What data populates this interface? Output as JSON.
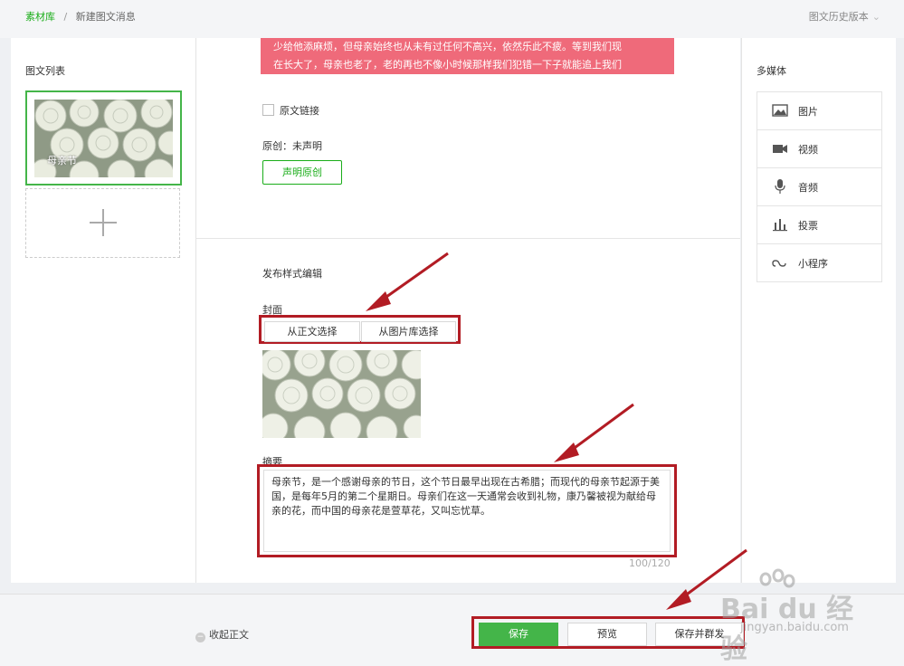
{
  "breadcrumb": {
    "root": "素材库",
    "separator": "/",
    "current": "新建图文消息"
  },
  "history": {
    "label": "图文历史版本"
  },
  "article_list": {
    "title": "图文列表",
    "item_title": "母亲节"
  },
  "editor": {
    "preview_text_line1": "少给他添麻烦，但母亲始终也从未有过任何不高兴，依然乐此不疲。等到我们现",
    "preview_text_line2": "在长大了，母亲也老了，老的再也不像小时候那样我们犯错一下子就能追上我们",
    "original_link_label": "原文链接",
    "original_status": "原创：未声明",
    "declare_button": "声明原创"
  },
  "publish": {
    "section_title": "发布样式编辑",
    "cover_label": "封面",
    "cover_from_body": "从正文选择",
    "cover_from_library": "从图片库选择",
    "abstract_label": "摘要",
    "abstract_text": "母亲节，是一个感谢母亲的节日，这个节日最早出现在古希腊；而现代的母亲节起源于美国，是每年5月的第二个星期日。母亲们在这一天通常会收到礼物，康乃馨被视为献给母亲的花，而中国的母亲花是萱草花，又叫忘忧草。",
    "counter": "100/120"
  },
  "multimedia": {
    "title": "多媒体",
    "items": [
      {
        "label": "图片",
        "icon": "image-icon"
      },
      {
        "label": "视频",
        "icon": "video-icon"
      },
      {
        "label": "音频",
        "icon": "microphone-icon"
      },
      {
        "label": "投票",
        "icon": "vote-chart-icon"
      },
      {
        "label": "小程序",
        "icon": "mini-program-icon"
      }
    ]
  },
  "footer": {
    "collapse_label": "收起正文",
    "save": "保存",
    "preview": "预览",
    "save_and_publish": "保存并群发"
  },
  "watermark": {
    "brand": "Bai du 经验",
    "url": "jingyan.baidu.com"
  },
  "colors": {
    "accent": "#1aad19",
    "annotation": "#b21c24",
    "highlight_text_bg": "#ef6a7a"
  }
}
